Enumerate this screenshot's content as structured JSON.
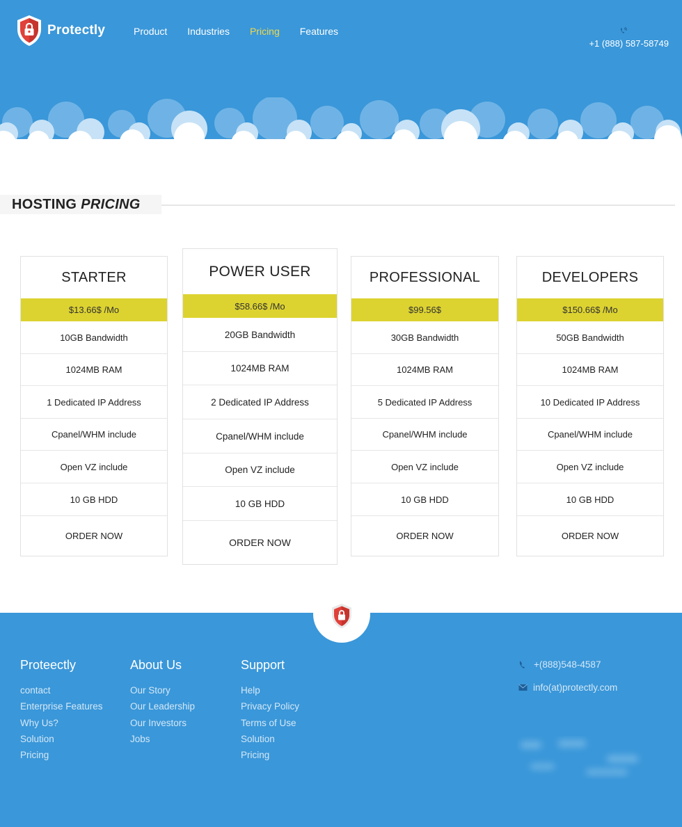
{
  "header": {
    "brand": "Protectly",
    "logo_icon": "shield-lock-icon",
    "nav": [
      {
        "label": "Product",
        "active": false
      },
      {
        "label": "Industries",
        "active": false
      },
      {
        "label": "Pricing",
        "active": true
      },
      {
        "label": "Features",
        "active": false
      }
    ],
    "phone_icon": "phone-icon",
    "phone": "+1 (888) 587-58749"
  },
  "section": {
    "title_regular": "HOSTING",
    "title_emphasis": "PRICING"
  },
  "plans": [
    {
      "name": "STARTER",
      "price": "$13.66$ /Mo",
      "features": [
        "10GB Bandwidth",
        "1024MB RAM",
        "1 Dedicated IP Address",
        "Cpanel/WHM include",
        "Open VZ include",
        "10 GB HDD"
      ],
      "order_label": "ORDER NOW",
      "featured": false
    },
    {
      "name": "POWER USER",
      "price": "$58.66$ /Mo",
      "features": [
        "20GB Bandwidth",
        "1024MB RAM",
        "2 Dedicated IP Address",
        "Cpanel/WHM include",
        "Open VZ include",
        "10 GB HDD"
      ],
      "order_label": "ORDER NOW",
      "featured": true
    },
    {
      "name": "PROFESSIONAL",
      "price": "$99.56$",
      "features": [
        "30GB Bandwidth",
        "1024MB RAM",
        "5 Dedicated IP Address",
        "Cpanel/WHM include",
        "Open VZ include",
        "10 GB HDD"
      ],
      "order_label": "ORDER NOW",
      "featured": false
    },
    {
      "name": "DEVELOPERS",
      "price": "$150.66$ /Mo",
      "features": [
        "50GB Bandwidth",
        "1024MB RAM",
        "10 Dedicated IP Address",
        "Cpanel/WHM include",
        "Open VZ include",
        "10 GB HDD"
      ],
      "order_label": "ORDER NOW",
      "featured": false
    }
  ],
  "footer": {
    "badge_icon": "shield-lock-icon",
    "columns": [
      {
        "title": "Proteectly",
        "links": [
          "contact",
          "Enterprise Features",
          "Why Us?",
          "Solution",
          "Pricing"
        ]
      },
      {
        "title": "About Us",
        "links": [
          "Our Story",
          "Our Leadership",
          "Our Investors",
          "Jobs"
        ]
      },
      {
        "title": "Support",
        "links": [
          "Help",
          "Privacy Policy",
          "Terms of Use",
          "Solution",
          "Pricing"
        ]
      }
    ],
    "contact": {
      "phone_icon": "phone-icon",
      "phone": "+(888)548-4587",
      "email_icon": "envelope-icon",
      "email": "info(at)protectly.com"
    }
  },
  "colors": {
    "primary_blue": "#3a97d9",
    "accent_yellow": "#ddd330",
    "nav_active": "#f0d94a",
    "shield_red": "#e0413a",
    "white": "#ffffff"
  }
}
